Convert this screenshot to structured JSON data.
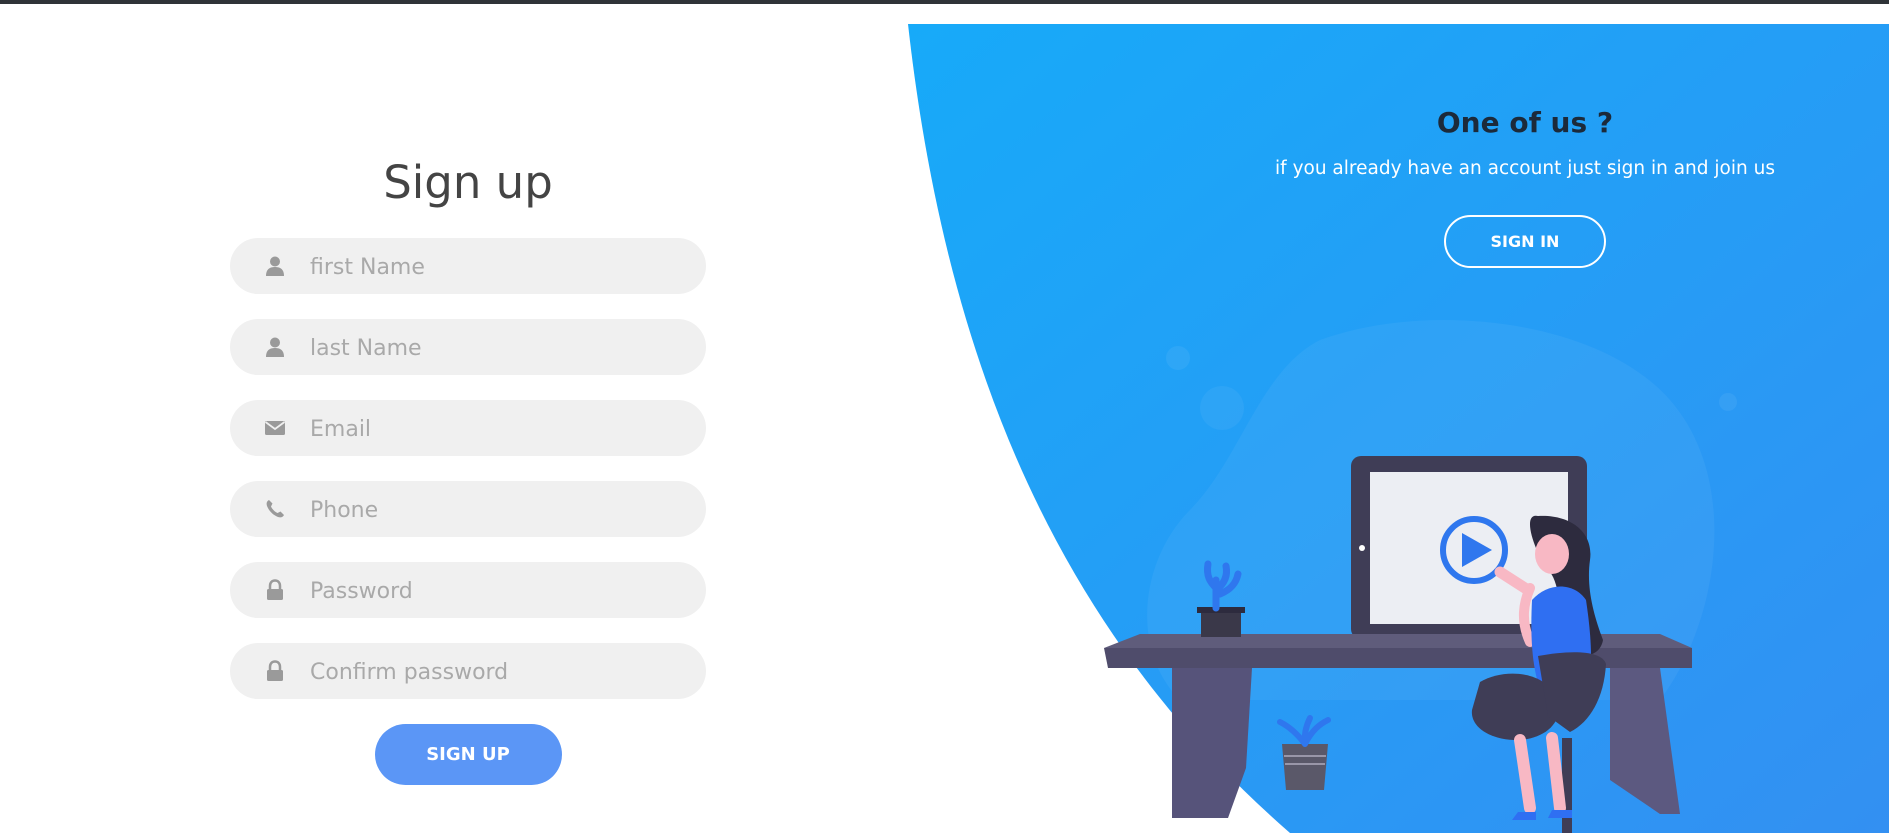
{
  "signup": {
    "title": "Sign up",
    "fields": [
      {
        "icon": "user-icon",
        "placeholder": "first Name"
      },
      {
        "icon": "user-icon",
        "placeholder": "last Name"
      },
      {
        "icon": "envelope-icon",
        "placeholder": "Email"
      },
      {
        "icon": "phone-icon",
        "placeholder": "Phone"
      },
      {
        "icon": "lock-icon",
        "placeholder": "Password"
      },
      {
        "icon": "lock-icon",
        "placeholder": "Confirm password"
      }
    ],
    "button_label": "SIGN UP"
  },
  "panel": {
    "title": "One of us ?",
    "subtitle": "if you already have an account just sign in and join us",
    "button_label": "SIGN IN"
  },
  "colors": {
    "accent_blue": "#1aa8f8",
    "accent_blue_dark": "#2f8ff2",
    "button_blue": "#5b96f6",
    "field_bg": "#f0f0f0",
    "placeholder": "#a9a9a9"
  }
}
